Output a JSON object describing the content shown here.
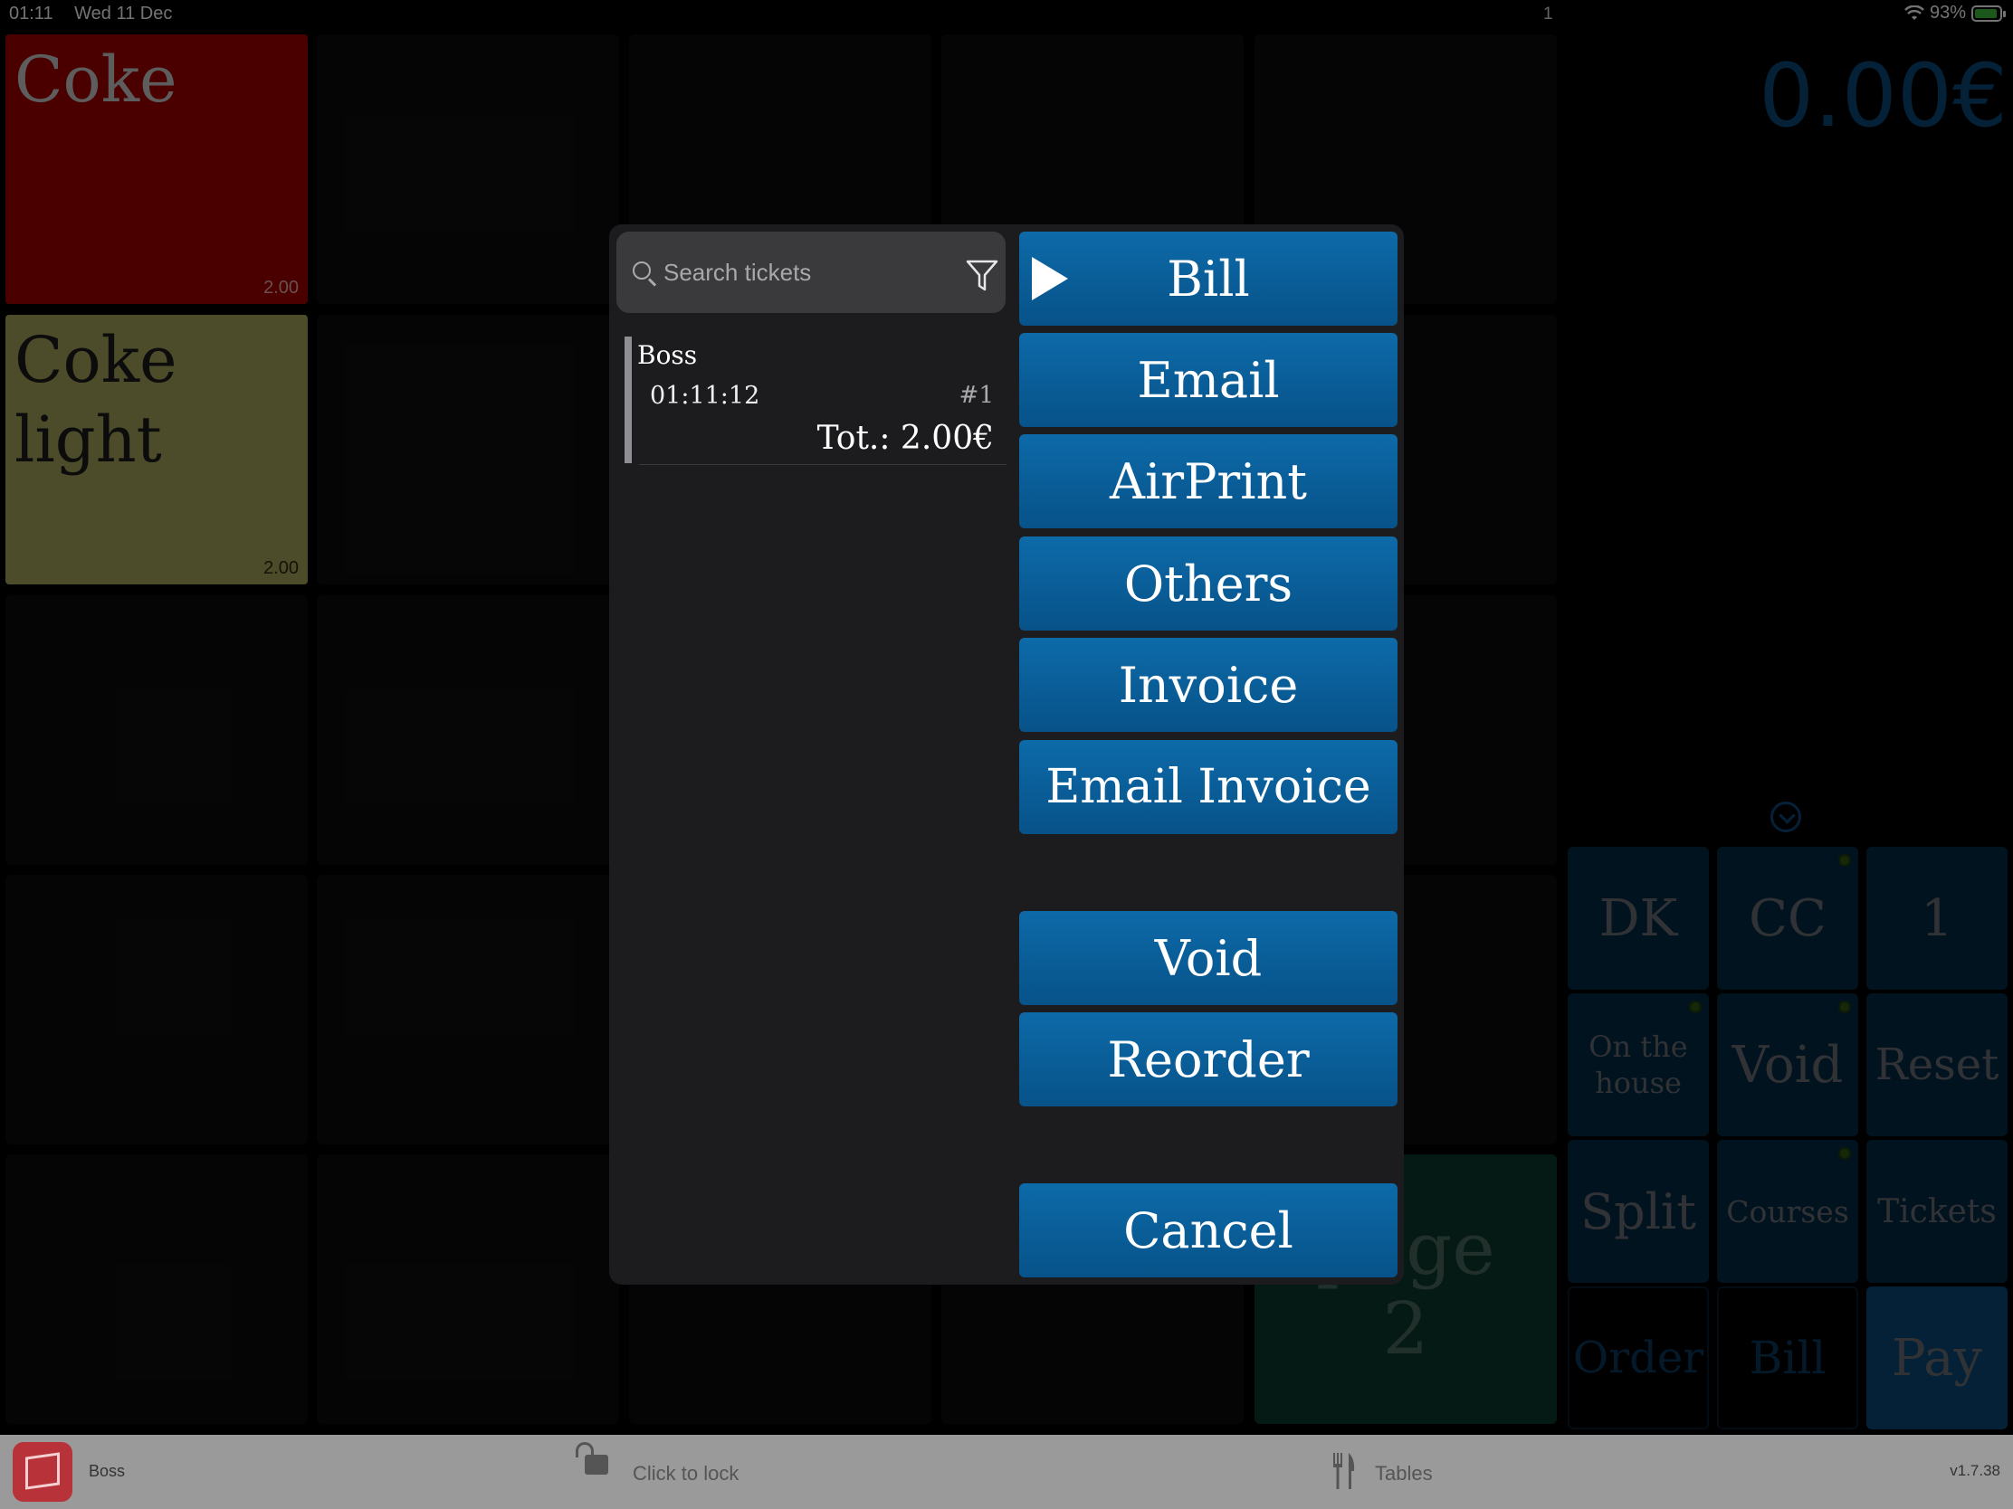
{
  "status_bar": {
    "time": "01:11",
    "date": "Wed 11 Dec",
    "center": "1",
    "battery": "93%"
  },
  "products": [
    {
      "name": "Coke",
      "price": "2.00",
      "color": "#a70000"
    },
    {
      "name": "Coke light",
      "price": "2.00",
      "color": "#a9a65d"
    }
  ],
  "order_total": "0.00€",
  "function_keys": {
    "dk": "DK",
    "cc": "CC",
    "one": "1",
    "on_the_house": "On the house",
    "void": "Void",
    "reset": "Reset",
    "split": "Split",
    "courses": "Courses",
    "tickets": "Tickets",
    "order": "Order",
    "bill": "Bill",
    "pay": "Pay"
  },
  "page2_button": {
    "line1": "page",
    "line2": "2"
  },
  "modal": {
    "search_placeholder": "Search tickets",
    "ticket": {
      "name": "Boss",
      "time": "01:11:12",
      "number": "#1",
      "total": "Tot.: 2.00€"
    },
    "actions": {
      "bill": "Bill",
      "email": "Email",
      "airprint": "AirPrint",
      "others": "Others",
      "invoice": "Invoice",
      "email_invoice": "Email Invoice",
      "void": "Void",
      "reorder": "Reorder",
      "cancel": "Cancel"
    }
  },
  "bottom_bar": {
    "user": "Boss",
    "lock": "Click to lock",
    "tables": "Tables",
    "version": "v1.7.38"
  },
  "colors": {
    "accent": "#0a63a0",
    "modal_bg": "#1c1c1e",
    "function_key_bg": "#062c48"
  }
}
